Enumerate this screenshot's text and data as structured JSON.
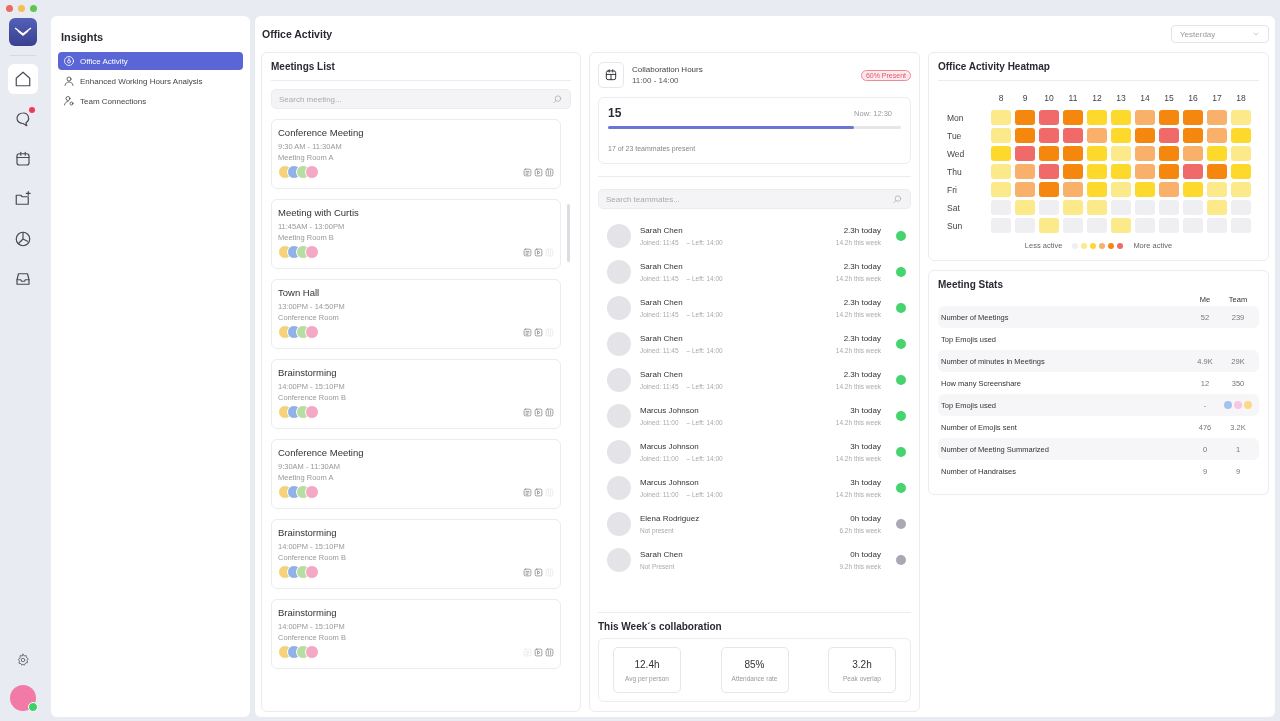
{
  "nav": {
    "items": [
      {
        "kind": "home",
        "selected": true,
        "badge": false
      },
      {
        "kind": "chat",
        "selected": false,
        "badge": true
      },
      {
        "kind": "calendar",
        "selected": false,
        "badge": false
      },
      {
        "kind": "folder",
        "selected": false,
        "badge": false
      },
      {
        "kind": "chart",
        "selected": false,
        "badge": false
      },
      {
        "kind": "inbox",
        "selected": false,
        "badge": false
      }
    ],
    "user": {
      "online": true
    }
  },
  "sidebar": {
    "title": "Insights",
    "items": [
      {
        "label": "Office Activity",
        "kind": "target",
        "selected": true
      },
      {
        "label": "Enhanced Working Hours Analysis",
        "kind": "person",
        "selected": false
      },
      {
        "label": "Team Connections",
        "kind": "team",
        "selected": false
      }
    ]
  },
  "page_title": "Office Activity",
  "period_select": {
    "value": "Yesterday"
  },
  "meetings": {
    "title": "Meetings List",
    "search": {
      "placeholder": "Search meeting..."
    },
    "items": [
      {
        "title": "Conference Meeting",
        "time": "9:30 AM - 11:30AM",
        "room": "Meeting Room A",
        "actions": [
          {
            "kind": "notes",
            "enabled": true
          },
          {
            "kind": "play",
            "enabled": true
          },
          {
            "kind": "list",
            "enabled": true
          }
        ]
      },
      {
        "title": "Meeting with Curtis",
        "time": "11:45AM - 13:00PM",
        "room": "Meeting Room B",
        "actions": [
          {
            "kind": "notes",
            "enabled": true
          },
          {
            "kind": "play",
            "enabled": true
          },
          {
            "kind": "list",
            "enabled": false
          }
        ]
      },
      {
        "title": "Town Hall",
        "time": "13:00PM - 14:50PM",
        "room": "Conference Room",
        "actions": [
          {
            "kind": "notes",
            "enabled": true
          },
          {
            "kind": "play",
            "enabled": true
          },
          {
            "kind": "list",
            "enabled": false
          }
        ]
      },
      {
        "title": "Brainstorming",
        "time": "14:00PM - 15:10PM",
        "room": "Conference Room B",
        "actions": [
          {
            "kind": "notes",
            "enabled": true
          },
          {
            "kind": "play",
            "enabled": true
          },
          {
            "kind": "list",
            "enabled": true
          }
        ]
      },
      {
        "title": "Conference Meeting",
        "time": "9:30AM - 11:30AM",
        "room": "Meeting Room A",
        "actions": [
          {
            "kind": "notes",
            "enabled": true
          },
          {
            "kind": "play",
            "enabled": true
          },
          {
            "kind": "list",
            "enabled": false
          }
        ]
      },
      {
        "title": "Brainstorming",
        "time": "14:00PM - 15:10PM",
        "room": "Conference Room B",
        "actions": [
          {
            "kind": "notes",
            "enabled": true
          },
          {
            "kind": "play",
            "enabled": true
          },
          {
            "kind": "list",
            "enabled": false
          }
        ]
      },
      {
        "title": "Brainstorming",
        "time": "14:00PM - 15:10PM",
        "room": "Conference Room B",
        "actions": [
          {
            "kind": "notes",
            "enabled": false
          },
          {
            "kind": "play",
            "enabled": true
          },
          {
            "kind": "list",
            "enabled": true
          }
        ]
      }
    ]
  },
  "collaboration": {
    "title": "Collaboration Hours",
    "hours": "11:00 - 14:00",
    "badge": "60% Present",
    "count": "15",
    "now": "Now: 12:30",
    "level": 0.84,
    "caption": "17 of 23 teammates present"
  },
  "teammates": {
    "search": {
      "placeholder": "Search teammates..."
    },
    "items": [
      {
        "name": "Sarah Chen",
        "present": true,
        "joined": "Joined: 11:45",
        "left": "– Left: 14:00",
        "today": "2.3h today",
        "week": "14.2h this week"
      },
      {
        "name": "Sarah Chen",
        "present": true,
        "joined": "Joined: 11:45",
        "left": "– Left: 14:00",
        "today": "2.3h today",
        "week": "14.2h this week"
      },
      {
        "name": "Sarah Chen",
        "present": true,
        "joined": "Joined: 11:45",
        "left": "– Left: 14:00",
        "today": "2.3h today",
        "week": "14.2h this week"
      },
      {
        "name": "Sarah Chen",
        "present": true,
        "joined": "Joined: 11:45",
        "left": "– Left: 14:00",
        "today": "2.3h today",
        "week": "14.2h this week"
      },
      {
        "name": "Sarah Chen",
        "present": true,
        "joined": "Joined: 11:45",
        "left": "– Left: 14:00",
        "today": "2.3h today",
        "week": "14.2h this week"
      },
      {
        "name": "Marcus Johnson",
        "present": true,
        "joined": "Joined: 11:00",
        "left": "– Left: 14:00",
        "today": "3h today",
        "week": "14.2h this week"
      },
      {
        "name": "Marcus Johnson",
        "present": true,
        "joined": "Joined: 11:00",
        "left": "– Left: 14:00",
        "today": "3h today",
        "week": "14.2h this week"
      },
      {
        "name": "Marcus Johnson",
        "present": true,
        "joined": "Joined: 11:00",
        "left": "– Left: 14:00",
        "today": "3h today",
        "week": "14.2h this week"
      },
      {
        "name": "Elena Rodriguez",
        "present": false,
        "note": "Not present",
        "today": "0h today",
        "week": "6.2h this week"
      },
      {
        "name": "Sarah Chen",
        "present": false,
        "note": "Not Present",
        "today": "0h today",
        "week": "9.2h this week"
      }
    ]
  },
  "week": {
    "title": "This Week´s collaboration",
    "stats": [
      {
        "value": "12.4h",
        "label": "Avg per person"
      },
      {
        "value": "85%",
        "label": "Attendance rate"
      },
      {
        "value": "3.2h",
        "label": "Peak overlap"
      }
    ]
  },
  "heatmap": {
    "title": "Office Activity Heatmap",
    "hours": [
      "8",
      "9",
      "10",
      "11",
      "12",
      "13",
      "14",
      "15",
      "16",
      "17",
      "18"
    ],
    "rows": [
      {
        "day": "Mon",
        "cells": [
          {
            "color": "#fbe98a"
          },
          {
            "color": "#f5870f"
          },
          {
            "color": "#f06a6a"
          },
          {
            "color": "#f5870f"
          },
          {
            "color": "#fcd92a"
          },
          {
            "color": "#fcd92a"
          },
          {
            "color": "#f8b06b"
          },
          {
            "color": "#f5870f"
          },
          {
            "color": "#f5870f"
          },
          {
            "color": "#f8b06b"
          },
          {
            "color": "#fbe98a"
          }
        ]
      },
      {
        "day": "Tue",
        "cells": [
          {
            "color": "#fbe98a"
          },
          {
            "color": "#f5870f"
          },
          {
            "color": "#f06a6a"
          },
          {
            "color": "#f06a6a"
          },
          {
            "color": "#f8b06b"
          },
          {
            "color": "#fcd92a"
          },
          {
            "color": "#f5870f"
          },
          {
            "color": "#f06a6a"
          },
          {
            "color": "#f5870f"
          },
          {
            "color": "#f8b06b"
          },
          {
            "color": "#fcd92a"
          }
        ]
      },
      {
        "day": "Wed",
        "cells": [
          {
            "color": "#fcd92a"
          },
          {
            "color": "#f06a6a"
          },
          {
            "color": "#f5870f"
          },
          {
            "color": "#f5870f"
          },
          {
            "color": "#fcd92a"
          },
          {
            "color": "#fbe98a"
          },
          {
            "color": "#f8b06b"
          },
          {
            "color": "#f5870f"
          },
          {
            "color": "#f8b06b"
          },
          {
            "color": "#fcd92a"
          },
          {
            "color": "#fbe98a"
          }
        ]
      },
      {
        "day": "Thu",
        "cells": [
          {
            "color": "#fbe98a"
          },
          {
            "color": "#f8b06b"
          },
          {
            "color": "#f06a6a"
          },
          {
            "color": "#f5870f"
          },
          {
            "color": "#fcd92a"
          },
          {
            "color": "#fcd92a"
          },
          {
            "color": "#f8b06b"
          },
          {
            "color": "#f5870f"
          },
          {
            "color": "#f06a6a"
          },
          {
            "color": "#f5870f"
          },
          {
            "color": "#fcd92a"
          }
        ]
      },
      {
        "day": "Fri",
        "cells": [
          {
            "color": "#fbe98a"
          },
          {
            "color": "#f8b06b"
          },
          {
            "color": "#f5870f"
          },
          {
            "color": "#f8b06b"
          },
          {
            "color": "#fcd92a"
          },
          {
            "color": "#fbe98a"
          },
          {
            "color": "#fcd92a"
          },
          {
            "color": "#f8b06b"
          },
          {
            "color": "#fcd92a"
          },
          {
            "color": "#fbe98a"
          },
          {
            "color": "#fbe98a"
          }
        ]
      },
      {
        "day": "Sat",
        "cells": [
          {
            "color": "#efeff1"
          },
          {
            "color": "#fbe98a"
          },
          {
            "color": "#efeff1"
          },
          {
            "color": "#fbe98a"
          },
          {
            "color": "#fbe98a"
          },
          {
            "color": "#efeff1"
          },
          {
            "color": "#efeff1"
          },
          {
            "color": "#efeff1"
          },
          {
            "color": "#efeff1"
          },
          {
            "color": "#fbe98a"
          },
          {
            "color": "#efeff1"
          }
        ]
      },
      {
        "day": "Sun",
        "cells": [
          {
            "color": "#efeff1"
          },
          {
            "color": "#efeff1"
          },
          {
            "color": "#fbe98a"
          },
          {
            "color": "#efeff1"
          },
          {
            "color": "#efeff1"
          },
          {
            "color": "#fbe98a"
          },
          {
            "color": "#efeff1"
          },
          {
            "color": "#efeff1"
          },
          {
            "color": "#efeff1"
          },
          {
            "color": "#efeff1"
          },
          {
            "color": "#efeff1"
          }
        ]
      }
    ],
    "legend": {
      "less": "Less active",
      "more": "More active",
      "steps": [
        {
          "color": "#efeff1"
        },
        {
          "color": "#fbe98a"
        },
        {
          "color": "#fcd92a"
        },
        {
          "color": "#f8b06b"
        },
        {
          "color": "#f5870f"
        },
        {
          "color": "#f06a6a"
        }
      ]
    }
  },
  "stats": {
    "title": "Meeting Stats",
    "columns": [
      "Me",
      "Team"
    ],
    "rows": [
      {
        "label": "Number of Meetings",
        "kind": "values",
        "me": "52",
        "team": "239"
      },
      {
        "label": "Top Emojis used",
        "kind": "empty"
      },
      {
        "label": "Number of minutes in Meetings",
        "kind": "values",
        "me": "4.9K",
        "team": "29K"
      },
      {
        "label": "How many Screenshare",
        "kind": "values",
        "me": "12",
        "team": "350"
      },
      {
        "label": "Top Emojis used",
        "kind": "emojis",
        "me": "-",
        "emojis": [
          {
            "color": "#a4c2f0"
          },
          {
            "color": "#f6c6e2"
          },
          {
            "color": "#fbd98a"
          }
        ]
      },
      {
        "label": "Number of Emojis sent",
        "kind": "values",
        "me": "476",
        "team": "3.2K"
      },
      {
        "label": "Number of Meeting Summarized",
        "kind": "values",
        "me": "0",
        "team": "1"
      },
      {
        "label": "Number of Handraises",
        "kind": "values",
        "me": "9",
        "team": "9"
      }
    ]
  }
}
